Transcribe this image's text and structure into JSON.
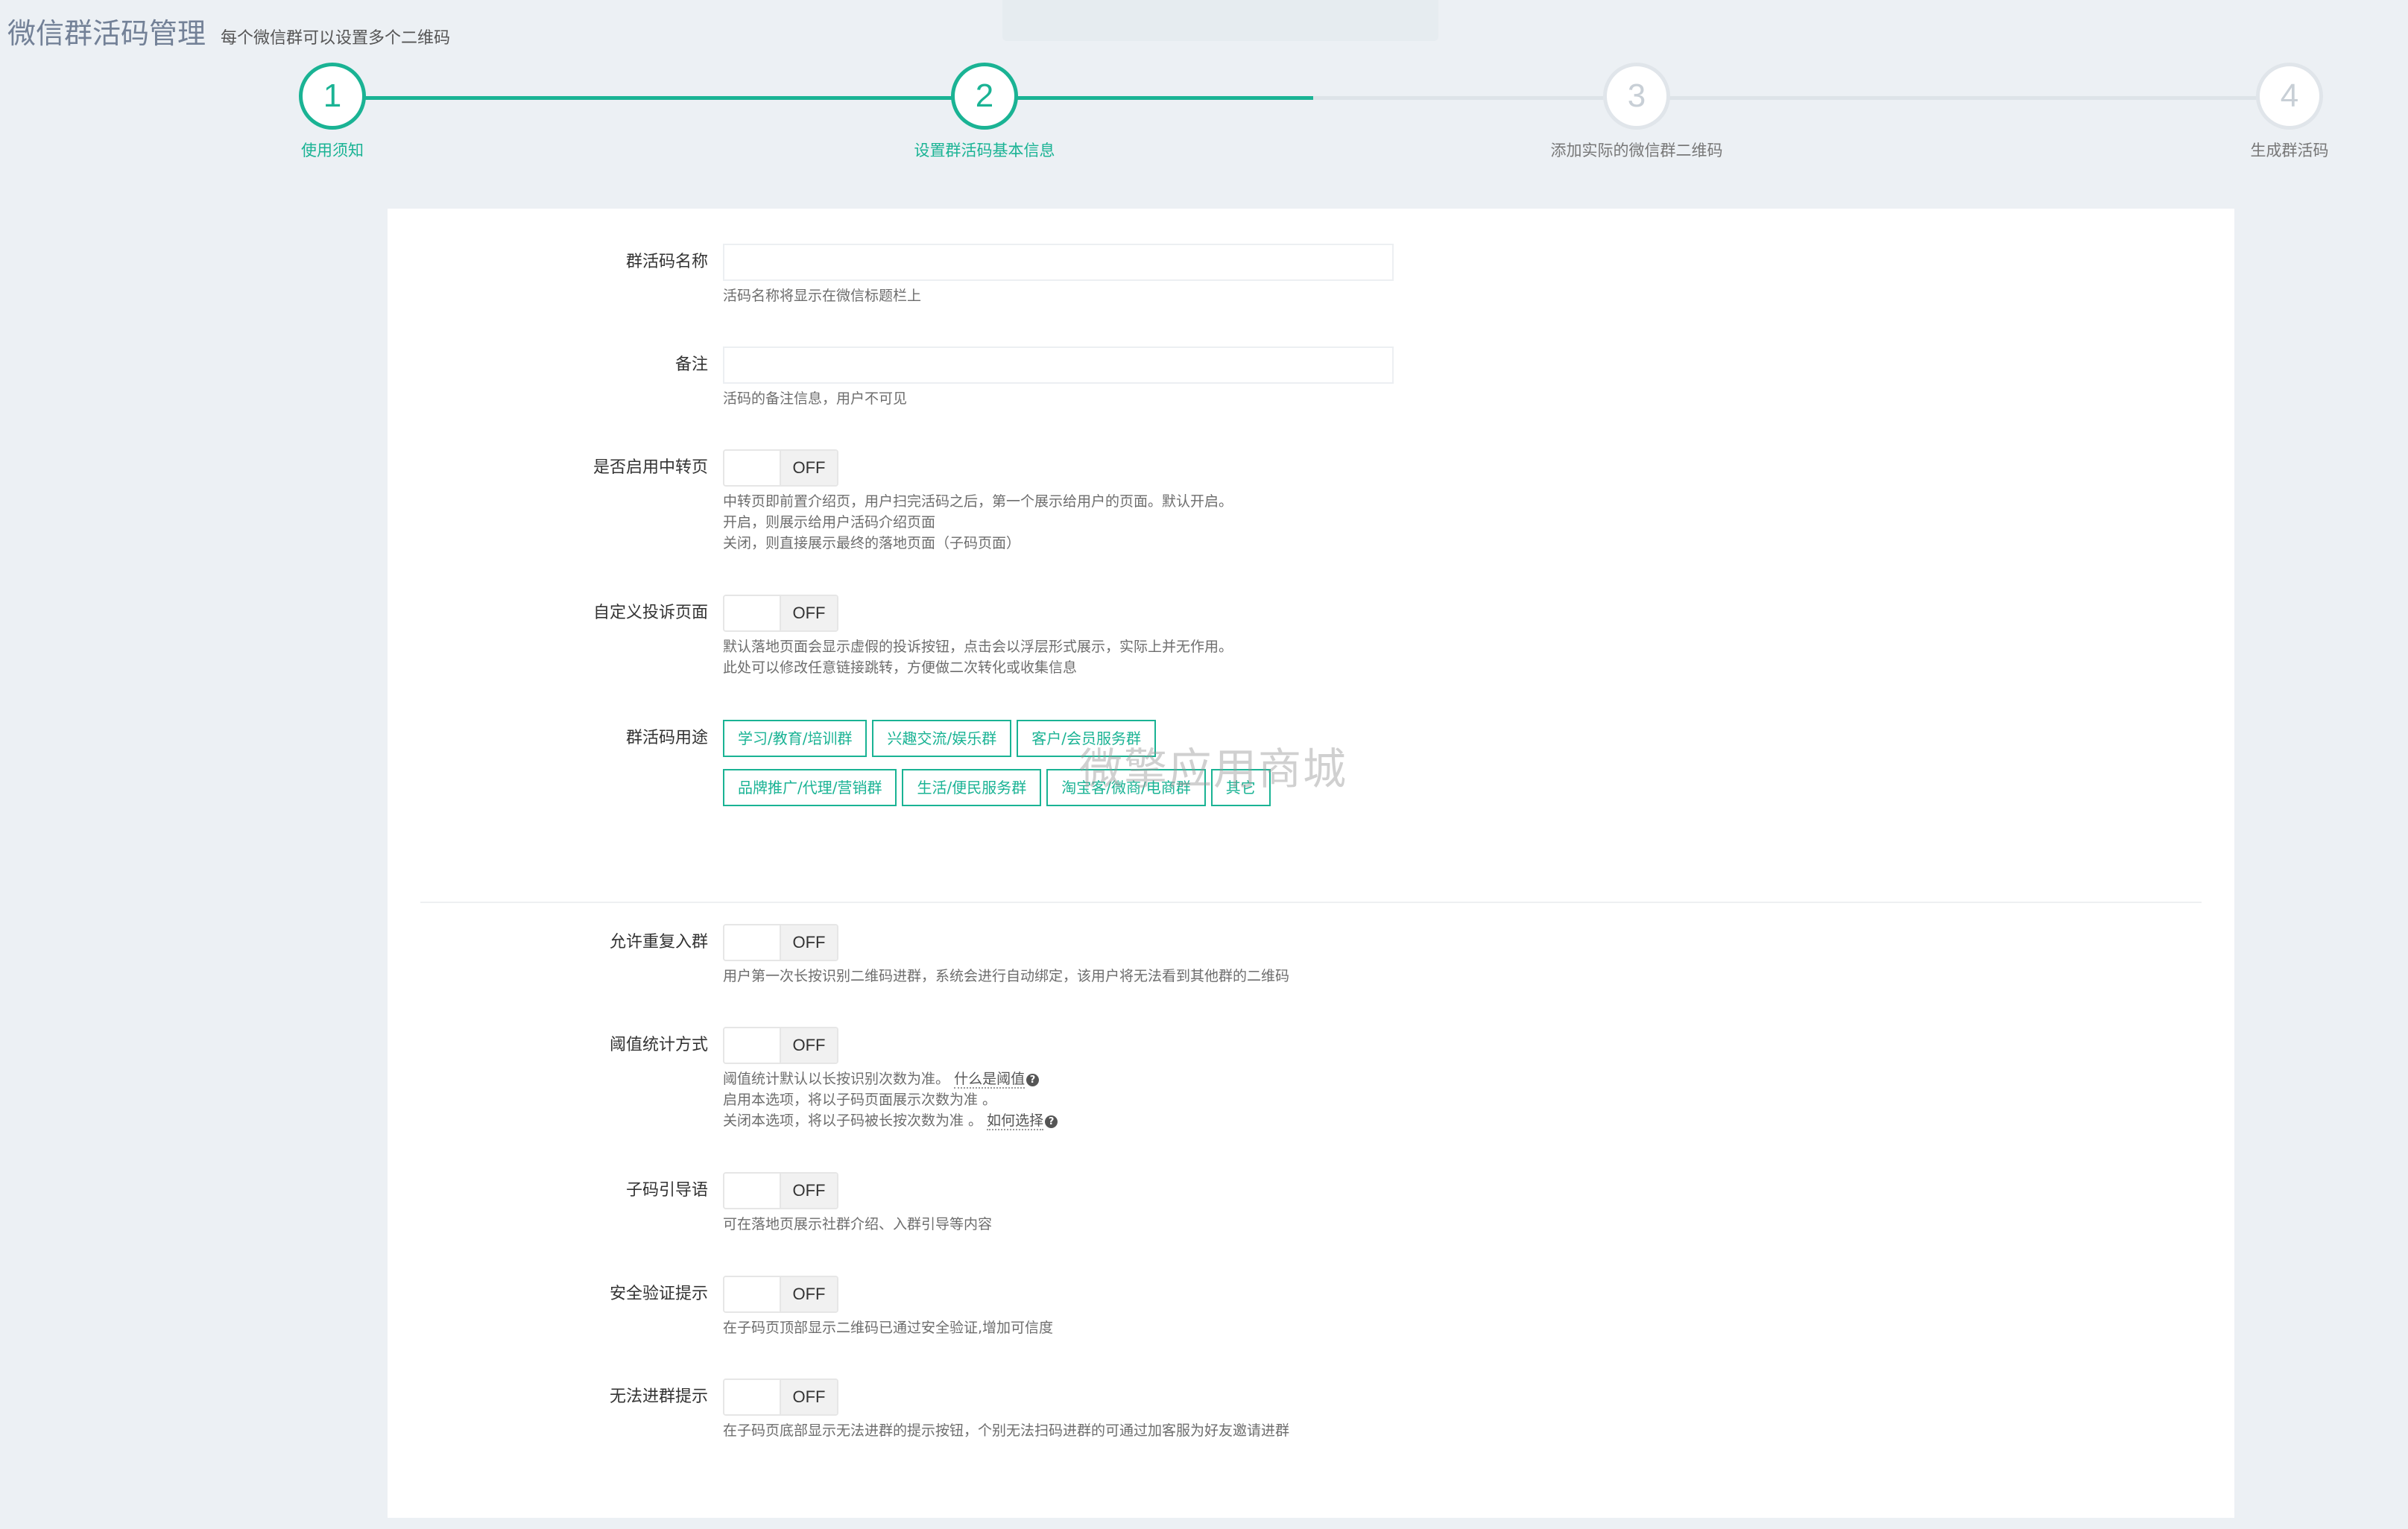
{
  "header": {
    "title": "微信群活码管理",
    "subtitle": "每个微信群可以设置多个二维码"
  },
  "steps": [
    {
      "number": "1",
      "label": "使用须知",
      "state": "done"
    },
    {
      "number": "2",
      "label": "设置群活码基本信息",
      "state": "active"
    },
    {
      "number": "3",
      "label": "添加实际的微信群二维码",
      "state": "todo"
    },
    {
      "number": "4",
      "label": "生成群活码",
      "state": "todo"
    }
  ],
  "form": {
    "name": {
      "label": "群活码名称",
      "value": "",
      "placeholder": "",
      "help": "活码名称将显示在微信标题栏上"
    },
    "remark": {
      "label": "备注",
      "value": "",
      "placeholder": "",
      "help": "活码的备注信息，用户不可见"
    },
    "transfer_page": {
      "label": "是否启用中转页",
      "state": "OFF",
      "help": [
        "中转页即前置介绍页，用户扫完活码之后，第一个展示给用户的页面。默认开启。",
        "开启，则展示给用户活码介绍页面",
        "关闭，则直接展示最终的落地页面（子码页面）"
      ]
    },
    "complaint_page": {
      "label": "自定义投诉页面",
      "state": "OFF",
      "help": [
        "默认落地页面会显示虚假的投诉按钮，点击会以浮层形式展示，实际上并无作用。",
        "此处可以修改任意链接跳转，方便做二次转化或收集信息"
      ]
    },
    "purpose": {
      "label": "群活码用途",
      "tags": [
        "学习/教育/培训群",
        "兴趣交流/娱乐群",
        "客户/会员服务群",
        "品牌推广/代理/营销群",
        "生活/便民服务群",
        "淘宝客/微商/电商群",
        "其它"
      ]
    },
    "allow_rejoin": {
      "label": "允许重复入群",
      "state": "OFF",
      "help": "用户第一次长按识别二维码进群，系统会进行自动绑定，该用户将无法看到其他群的二维码"
    },
    "threshold": {
      "label": "阈值统计方式",
      "state": "OFF",
      "help_line1": "阈值统计默认以长按识别次数为准。",
      "help_link1": "什么是阈值",
      "help_line2": "启用本选项，将以子码页面展示次数为准 。",
      "help_line3": "关闭本选项，将以子码被长按次数为准 。",
      "help_link2": "如何选择"
    },
    "guide_text": {
      "label": "子码引导语",
      "state": "OFF",
      "help": "可在落地页展示社群介绍、入群引导等内容"
    },
    "security_tip": {
      "label": "安全验证提示",
      "state": "OFF",
      "help": "在子码页顶部显示二维码已通过安全验证,增加可信度"
    },
    "cannot_join_tip": {
      "label": "无法进群提示",
      "state": "OFF",
      "help": "在子码页底部显示无法进群的提示按钮，个别无法扫码进群的可通过加客服为好友邀请进群"
    }
  },
  "watermark": "微擎应用商城",
  "colors": {
    "accent": "#1ab394",
    "page_bg": "#ecf0f4",
    "title": "#738197"
  }
}
